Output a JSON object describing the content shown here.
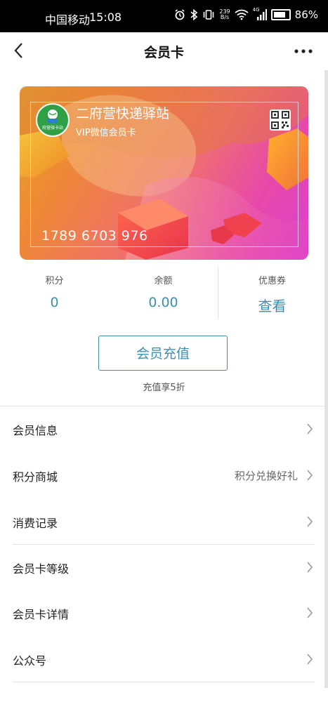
{
  "status_bar": {
    "carrier": "中国移动",
    "time": "15:08",
    "network_speed_value": "239",
    "network_speed_unit": "B/s",
    "signal_type": "4G",
    "battery": "86%"
  },
  "nav": {
    "title": "会员卡"
  },
  "card": {
    "shop_name": "二府营快递驿站",
    "card_type": "VIP微信会员卡",
    "card_number": "1789 6703 976",
    "logo_text": "府营驿卡站"
  },
  "stats": [
    {
      "label": "积分",
      "value": "0"
    },
    {
      "label": "余额",
      "value": "0.00"
    },
    {
      "label": "优惠券",
      "value": "查看"
    }
  ],
  "recharge": {
    "button_label": "会员充值",
    "note": "充值享5折"
  },
  "menu": [
    {
      "label": "会员信息",
      "hint": ""
    },
    {
      "label": "积分商城",
      "hint": "积分兑换好礼"
    },
    {
      "label": "消费记录",
      "hint": ""
    },
    {
      "label": "会员卡等级",
      "hint": ""
    },
    {
      "label": "会员卡详情",
      "hint": ""
    },
    {
      "label": "公众号",
      "hint": ""
    }
  ],
  "colors": {
    "accent": "#3d8fb0",
    "status_bar_bg": "#000000",
    "divider": "#e3e3e3"
  },
  "icons": [
    "alarm-icon",
    "bluetooth-icon",
    "vibrate-icon",
    "wifi-icon",
    "signal-icon",
    "battery-icon",
    "back-arrow-icon",
    "more-icon",
    "qr-code-icon",
    "chevron-right-icon"
  ]
}
